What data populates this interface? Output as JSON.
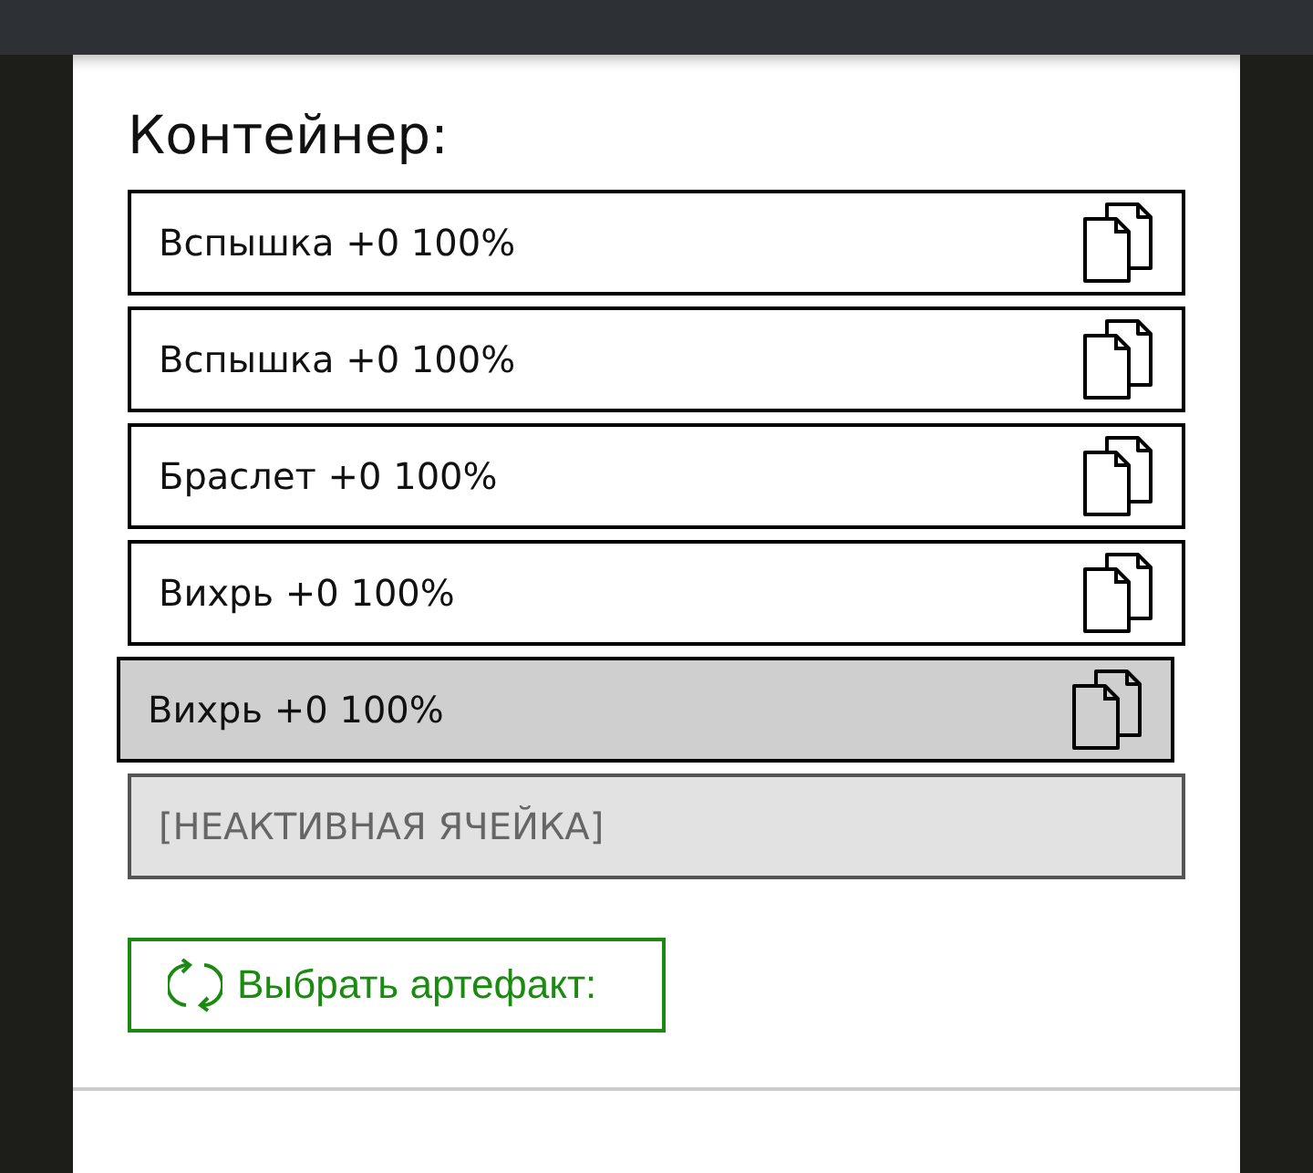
{
  "title": "Контейнер:",
  "slots": [
    {
      "kind": "item",
      "label": "Вспышка +0 100%",
      "selected": false
    },
    {
      "kind": "item",
      "label": "Вспышка +0 100%",
      "selected": false
    },
    {
      "kind": "item",
      "label": "Браслет +0 100%",
      "selected": false
    },
    {
      "kind": "item",
      "label": "Вихрь +0 100%",
      "selected": false
    },
    {
      "kind": "item",
      "label": "Вихрь +0 100%",
      "selected": true
    },
    {
      "kind": "empty",
      "label": "[НЕАКТИВНАЯ ЯЧЕЙКА]"
    }
  ],
  "button": {
    "label": "Выбрать артефакт:"
  }
}
